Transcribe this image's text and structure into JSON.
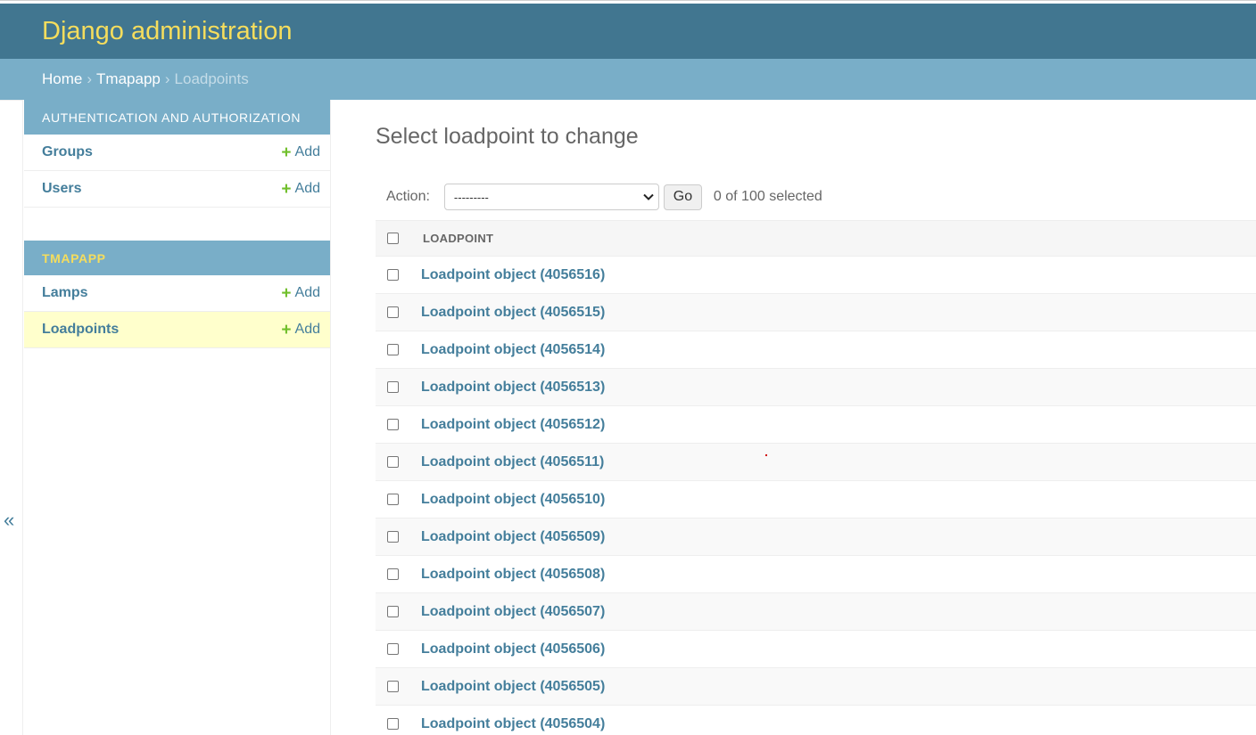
{
  "header": {
    "site_name": "Django administration"
  },
  "breadcrumbs": {
    "home": "Home",
    "sep1": "›",
    "app": "Tmapapp",
    "sep2": "›",
    "current": "Loadpoints"
  },
  "sidebar": {
    "toggle_icon": "«",
    "modules": [
      {
        "caption": "Authentication and Authorization",
        "models": [
          {
            "name": "Groups",
            "add_icon": "+",
            "add_label": "Add"
          },
          {
            "name": "Users",
            "add_icon": "+",
            "add_label": "Add"
          }
        ]
      },
      {
        "caption": "Tmapapp",
        "models": [
          {
            "name": "Lamps",
            "add_icon": "+",
            "add_label": "Add"
          },
          {
            "name": "Loadpoints",
            "add_icon": "+",
            "add_label": "Add",
            "current": true
          }
        ]
      }
    ]
  },
  "content": {
    "title": "Select loadpoint to change",
    "actions": {
      "label": "Action:",
      "selected": "---------",
      "go_label": "Go",
      "counter": "0 of 100 selected"
    },
    "table": {
      "column_header": "LOADPOINT",
      "rows": [
        "Loadpoint object (4056516)",
        "Loadpoint object (4056515)",
        "Loadpoint object (4056514)",
        "Loadpoint object (4056513)",
        "Loadpoint object (4056512)",
        "Loadpoint object (4056511)",
        "Loadpoint object (4056510)",
        "Loadpoint object (4056509)",
        "Loadpoint object (4056508)",
        "Loadpoint object (4056507)",
        "Loadpoint object (4056506)",
        "Loadpoint object (4056505)",
        "Loadpoint object (4056504)"
      ]
    }
  },
  "colors": {
    "header_bg": "#417690",
    "breadcrumbs_bg": "#79aec8",
    "site_name": "#f5dd5d",
    "link": "#447e9b",
    "add_plus": "#70bf2b",
    "current_row_bg": "#ffffcc"
  },
  "icons": {
    "add": "plus-icon",
    "toggle": "double-chevron-left-icon",
    "select": "chevron-down-icon"
  }
}
